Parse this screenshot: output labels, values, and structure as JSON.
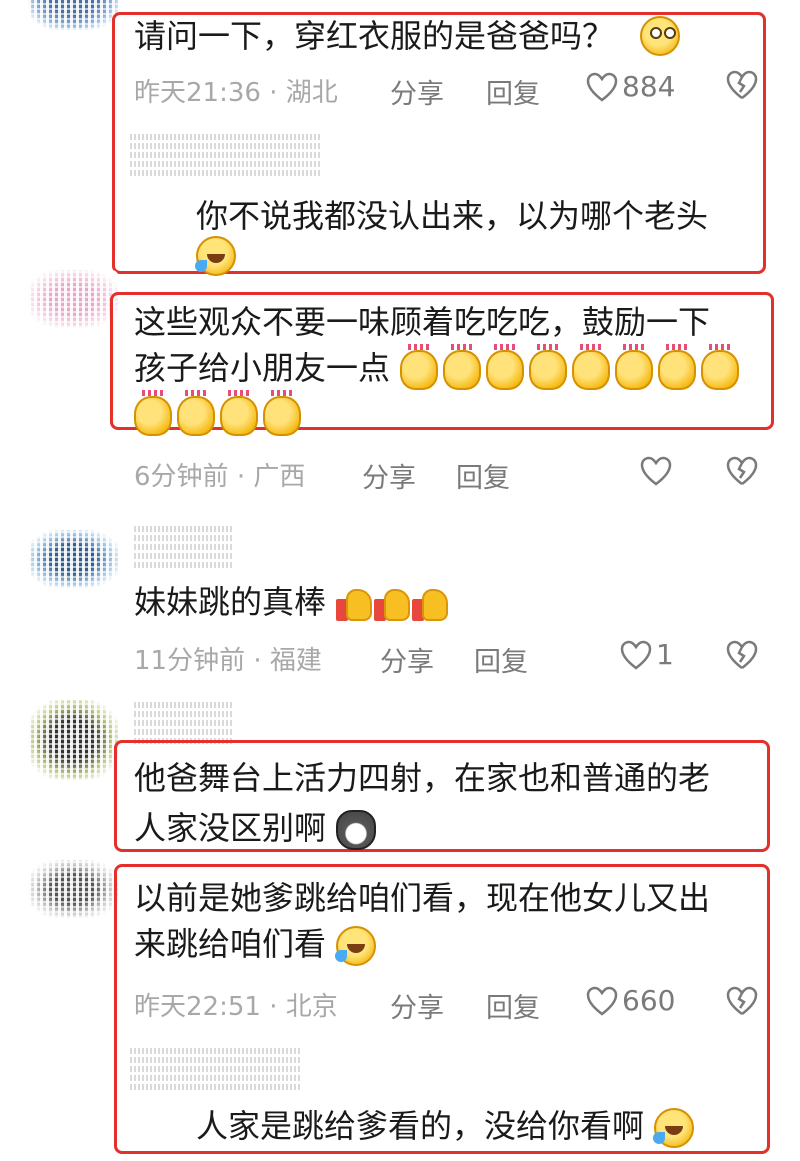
{
  "comments": [
    {
      "text": "请问一下，穿红衣服的是爸爸吗？",
      "time": "昨天21:36",
      "location": "湖北",
      "share": "分享",
      "reply": "回复",
      "likes": "884",
      "reply_text": "你不说我都没认出来，以为哪个老头",
      "icons": [
        "thinking-face-icon",
        "rolling-laugh-icon"
      ]
    },
    {
      "text_line1": "这些观众不要一味顾着吃吃吃，鼓励一下",
      "text_line2": "孩子给小朋友一点",
      "time": "6分钟前",
      "location": "广西",
      "share": "分享",
      "reply": "回复",
      "icons": [
        "clapping-hands-icon"
      ]
    },
    {
      "text": "妹妹跳的真棒",
      "time": "11分钟前",
      "location": "福建",
      "share": "分享",
      "reply": "回复",
      "likes": "1",
      "icons": [
        "thumbs-up-icon"
      ]
    },
    {
      "text_line1": "他爸舞台上活力四射，在家也和普通的老",
      "text_line2": "人家没区别啊",
      "icons": [
        "husky-icon"
      ]
    },
    {
      "text_line1": "以前是她爹跳给咱们看，现在他女儿又出",
      "text_line2": "来跳给咱们看",
      "time": "昨天22:51",
      "location": "北京",
      "share": "分享",
      "reply": "回复",
      "likes": "660",
      "reply_text": "人家是跳给爹看的，没给你看啊",
      "icons": [
        "rolling-laugh-icon"
      ]
    }
  ],
  "separator": "·",
  "colors": {
    "highlight_border": "#e3302b",
    "meta_text": "#a8a8a8",
    "body_text": "#1a1a1a"
  }
}
